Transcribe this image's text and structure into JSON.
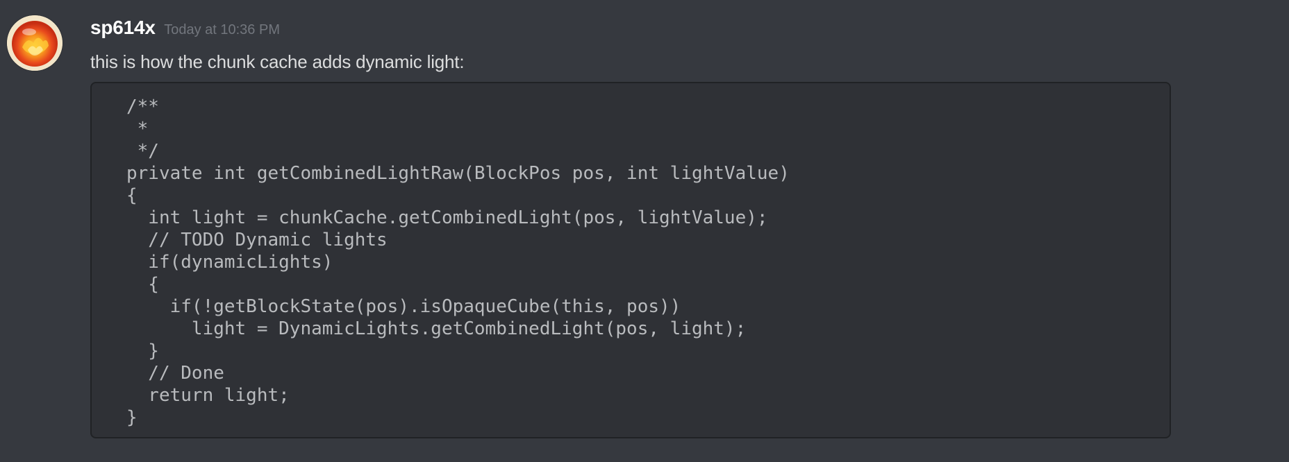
{
  "message": {
    "author": {
      "name": "sp614x",
      "avatar_icon": "fire-orb-avatar-icon"
    },
    "timestamp": "Today at 10:36 PM",
    "text": "this is how the chunk cache adds dynamic light:",
    "code_lines": [
      "/**",
      " *",
      " */",
      "private int getCombinedLightRaw(BlockPos pos, int lightValue)",
      "{",
      "  int light = chunkCache.getCombinedLight(pos, lightValue);",
      "  // TODO Dynamic lights",
      "  if(dynamicLights)",
      "  {",
      "    if(!getBlockState(pos).isOpaqueCube(this, pos))",
      "      light = DynamicLights.getCombinedLight(pos, light);",
      "  }",
      "  // Done",
      "  return light;",
      "}"
    ]
  },
  "colors": {
    "background": "#36393f",
    "code_background": "#2f3136",
    "code_border": "#202225",
    "username": "#ffffff",
    "timestamp": "#72767d",
    "text": "#dcddde",
    "code_text": "#b9bbbe"
  }
}
